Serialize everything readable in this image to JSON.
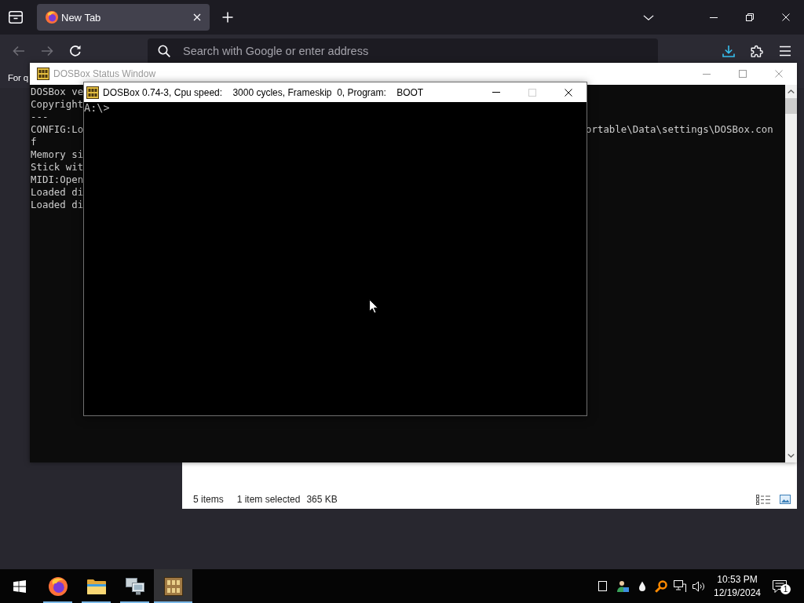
{
  "browser": {
    "tabs": [
      {
        "label": "New Tab",
        "selected": true
      }
    ],
    "nav_buttons": [
      {
        "kind": "back",
        "disabled": true
      },
      {
        "kind": "forward",
        "disabled": true
      },
      {
        "kind": "reload",
        "disabled": false
      }
    ],
    "address_bar": {
      "placeholder": "Search with Google or enter address"
    },
    "bookmarks_bar": {
      "text": "For q"
    }
  },
  "status_window": {
    "title": "DOSBox Status Window",
    "active": false,
    "lines": [
      {
        "left": "DOSBox ve"
      },
      {
        "left": "Copyright"
      },
      {
        "left": "---"
      },
      {
        "left": "CONFIG:Lo",
        "right": "ortable\\Data\\settings\\DOSBox.con"
      },
      {
        "left": "f"
      },
      {
        "left": "Memory si"
      },
      {
        "left": "Stick wit"
      },
      {
        "left": "MIDI:Open"
      },
      {
        "left": "Loaded di"
      },
      {
        "left": "Loaded di"
      }
    ]
  },
  "dosbox_window": {
    "title": "DOSBox 0.74-3, Cpu speed:    3000 cycles, Frameskip  0, Program:    BOOT",
    "active": true,
    "buttons": [
      {
        "kind": "minimize",
        "disabled": false
      },
      {
        "kind": "maximize",
        "disabled": true
      },
      {
        "kind": "close",
        "disabled": false
      }
    ],
    "screen_text": "A:\\>"
  },
  "explorer_status": {
    "items": "5 items",
    "selection": "1 item selected",
    "size": "365 KB"
  },
  "taskbar": {
    "apps": [
      {
        "kind": "browser",
        "running": true,
        "selected": false
      },
      {
        "kind": "folder",
        "running": true,
        "selected": false
      },
      {
        "kind": "monitor",
        "running": true,
        "selected": false
      },
      {
        "kind": "dosbox",
        "running": true,
        "selected": true
      }
    ],
    "clock": {
      "time": "10:53 PM",
      "date": "12/19/2024"
    },
    "notification_count": "1"
  }
}
